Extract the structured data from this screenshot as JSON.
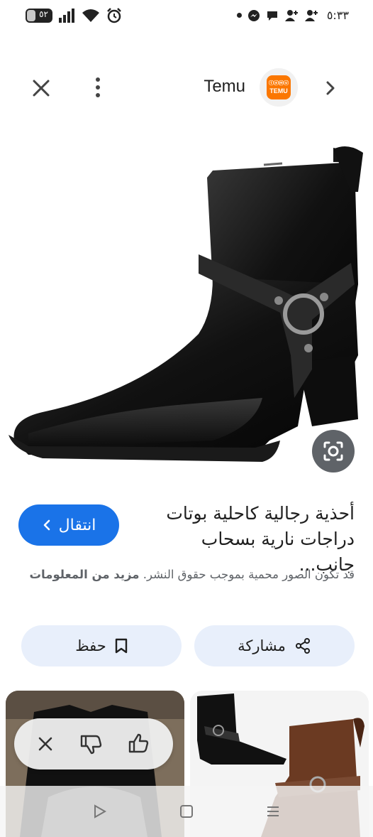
{
  "status_bar": {
    "time": "٥:٣٣",
    "battery_level": "٥٢"
  },
  "header": {
    "title": "Temu",
    "logo_text_top": "ⓣⓔⓜⓤ",
    "logo_text_bottom": "TEMU"
  },
  "product": {
    "title": "أحذية رجالية كاحلية بوتات دراجات نارية بسحاب جانب...",
    "visit_label": "انتقال",
    "copyright_text": "قد تكون الصور محمية بموجب حقوق النشر.",
    "more_info_label": "مزيد من المعلومات"
  },
  "actions": {
    "share_label": "مشاركة",
    "save_label": "حفظ"
  },
  "colors": {
    "accent": "#1a73e8",
    "temu_orange": "#fb7701",
    "pill_bg": "#e8effb"
  }
}
